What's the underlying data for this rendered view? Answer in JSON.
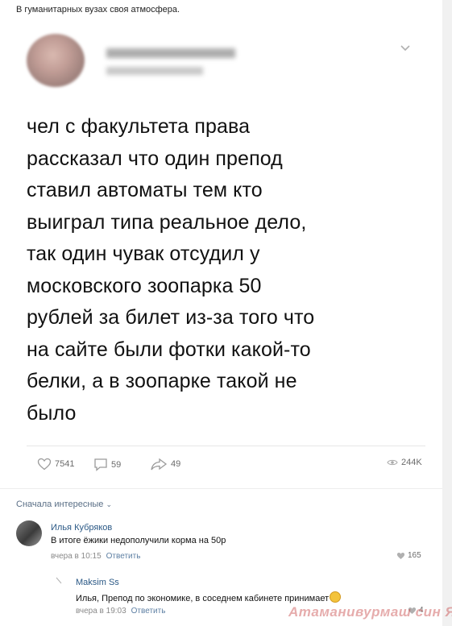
{
  "caption": "В гуманитарных вузах своя атмосфера.",
  "post": {
    "lines": [
      "чел с факультета права",
      "рассказал что один препод",
      "ставил автоматы тем кто",
      "выиграл типа реальное дело,",
      "так один чувак отсудил у",
      "московского зоопарка 50",
      "рублей за билет из-за того что",
      "на сайте были фотки какой-то",
      "белки, а в зоопарке такой не",
      "было"
    ]
  },
  "actions": {
    "likes": "7541",
    "comments": "59",
    "shares": "49",
    "views": "244K"
  },
  "sort_label": "Сначала интересные",
  "comments": [
    {
      "author": "Илья Кубряков",
      "text": "В итоге ёжики недополучили корма на 50р",
      "time": "вчера в 10:15",
      "reply": "Ответить",
      "likes": "165"
    },
    {
      "author": "Maksim Ss",
      "text": "Илья, Препод по экономике, в соседнем кабинете принимает",
      "time": "вчера в 19:03",
      "reply": "Ответить",
      "likes": "4"
    }
  ],
  "watermark": "Атаманивурмаш син ЯП",
  "colors": {
    "link": "#2a5885",
    "muted": "#8a8a8a"
  }
}
